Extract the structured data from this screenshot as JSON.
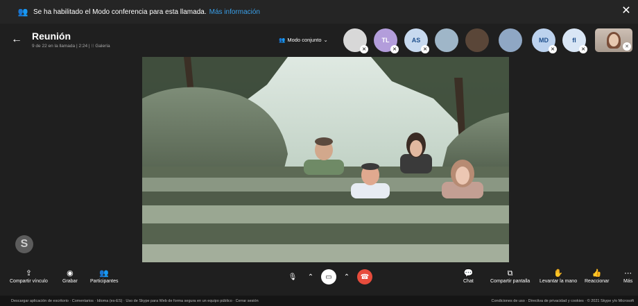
{
  "banner": {
    "icon": "group-call-icon",
    "text": "Se ha habilitado el Modo conferencia para esta llamada.",
    "link": "Más información",
    "close_icon": "close-icon"
  },
  "header": {
    "title": "Reunión",
    "subtitle": "9 de 22 en la llamada | 2:24 | ⁝⁝ Galería",
    "mode_label": "Modo conjunto"
  },
  "participants": [
    {
      "initials": "",
      "color": "#d8d8d8",
      "muted": true
    },
    {
      "initials": "TL",
      "color": "#b39ddb",
      "muted": true
    },
    {
      "initials": "AS",
      "color": "#c7d9ef",
      "muted": true
    },
    {
      "initials": "",
      "color": "#9fb6c8",
      "muted": false
    },
    {
      "initials": "",
      "color": "#5a4638",
      "muted": false
    },
    {
      "initials": "",
      "color": "#8fa7c4",
      "muted": false
    },
    {
      "initials": "MD",
      "color": "#bcd2ee",
      "muted": true
    },
    {
      "initials": "fl",
      "color": "#d9e6f5",
      "muted": true
    }
  ],
  "controls": {
    "share_link": "Compartir vínculo",
    "record": "Grabar",
    "participants": "Participantes",
    "chat": "Chat",
    "share_screen": "Compartir pantalla",
    "raise_hand": "Levantar la mano",
    "react": "Reaccionar",
    "more": "Más",
    "end_call_color": "#e74c3c"
  },
  "footer": {
    "left": "Descargar aplicación de escritorio  ·  Comentarios  ·  Idioma (es-ES)  ·  Uso de Skype para Web de forma segura en un equipo público  ·  Cerrar sesión",
    "right": "Condiciones de uso  ·  Directiva de privacidad y cookies  ·  © 2021 Skype y/o Microsoft"
  }
}
